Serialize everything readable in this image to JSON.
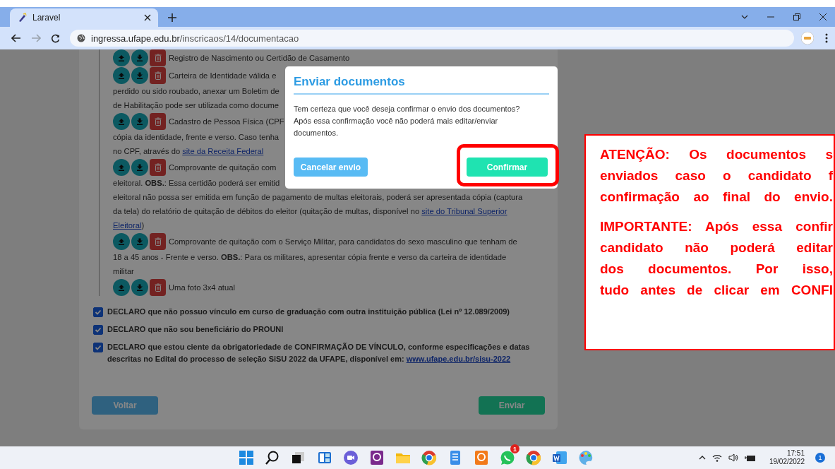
{
  "browser": {
    "tab": {
      "title": "Laravel",
      "selected": true
    },
    "address": {
      "host": "ingressa.ufape.edu.br",
      "path": "/inscricaos/14/documentacao"
    },
    "forward_disabled": true
  },
  "documents": [
    {
      "lines": [
        [
          {
            "kind": "text",
            "text": "Registro de Nascimento ou Certidão de Casamento"
          }
        ]
      ]
    },
    {
      "lines": [
        [
          {
            "kind": "text",
            "text": "Carteira de Identidade válida e"
          }
        ],
        [
          {
            "kind": "text",
            "text": "perdido ou sido roubado, anexar um Boletim de"
          }
        ],
        [
          {
            "kind": "text",
            "text": "de Habilitação pode ser utilizada como docume"
          }
        ]
      ]
    },
    {
      "lines": [
        [
          {
            "kind": "text",
            "text": "Cadastro de Pessoa Física (CPF"
          }
        ],
        [
          {
            "kind": "text",
            "text": "cópia da identidade, frente e verso. Caso tenha"
          }
        ],
        [
          {
            "kind": "text",
            "text": "no CPF, através do "
          },
          {
            "kind": "link",
            "text": "site da Receita Federal"
          }
        ]
      ]
    },
    {
      "lines": [
        [
          {
            "kind": "text",
            "text": "Comprovante de quitação com"
          }
        ],
        [
          {
            "kind": "text",
            "text": "eleitoral. **OBS.**: Essa certidão poderá ser emitid"
          }
        ],
        [
          {
            "kind": "text",
            "text": "eleitoral não possa ser emitida em função de pagamento de multas eleitorais, poderá ser apresentada cópia (captura"
          }
        ],
        [
          {
            "kind": "text",
            "text": "da tela) do relatório de quitação de débitos do eleitor (quitação de multas, disponível no "
          },
          {
            "kind": "link",
            "text": "site do Tribunal Superior"
          }
        ],
        [
          {
            "kind": "link",
            "text": "Eleitoral"
          },
          {
            "kind": "text",
            "text": ")"
          }
        ]
      ]
    },
    {
      "lines": [
        [
          {
            "kind": "text",
            "text": "Comprovante de quitação com o Serviço Militar, para candidatos do sexo masculino que tenham de"
          }
        ],
        [
          {
            "kind": "text",
            "text": "18 a 45 anos - Frente e verso. **OBS.**: Para os militares, apresentar cópia frente e verso da carteira de identidade"
          }
        ],
        [
          {
            "kind": "text",
            "text": "militar"
          }
        ]
      ]
    },
    {
      "lines": [
        [
          {
            "kind": "text",
            "text": "Uma foto 3x4 atual"
          }
        ]
      ]
    }
  ],
  "declarations": [
    {
      "checked": true,
      "parts": [
        {
          "kind": "text",
          "text": "DECLARO que não possuo vínculo em curso de graduação com outra instituição pública (Lei nº 12.089/2009)"
        }
      ]
    },
    {
      "checked": true,
      "parts": [
        {
          "kind": "text",
          "text": "DECLARO que não sou beneficiário do PROUNI"
        }
      ]
    },
    {
      "checked": true,
      "parts": [
        {
          "kind": "text",
          "text": "DECLARO que estou ciente da obrigatoriedade de CONFIRMAÇÃO DE VÍNCULO, conforme especificações e datas descritas no Edital do processo de seleção SiSU 2022 da UFAPE, disponível em: "
        },
        {
          "kind": "link",
          "text": "www.ufape.edu.br/sisu-2022"
        }
      ]
    }
  ],
  "actions": {
    "back": "Voltar",
    "submit": "Enviar"
  },
  "modal": {
    "title": "Enviar documentos",
    "message": "Tem certeza que você deseja confirmar o envio dos documentos? Após essa confirmação você não poderá mais editar/enviar documentos.",
    "cancel": "Cancelar envio",
    "confirm": "Confirmar",
    "confirm_highlighted": true
  },
  "callout": {
    "paragraphs": [
      [
        "ATENÇÃO: Os documentos s",
        "enviados caso o candidato f",
        "confirmação ao final do envio."
      ],
      [
        "IMPORTANTE: Após essa confir",
        "candidato não poderá editar",
        "dos documentos. Por isso,",
        "tudo antes de clicar em CONFI"
      ]
    ]
  },
  "taskbar": {
    "apps": [
      {
        "kind": "start"
      },
      {
        "kind": "search"
      },
      {
        "kind": "taskview"
      },
      {
        "kind": "widgets"
      },
      {
        "kind": "chat"
      },
      {
        "kind": "pdf"
      },
      {
        "kind": "folder"
      },
      {
        "kind": "browser"
      },
      {
        "kind": "notepad"
      },
      {
        "kind": "pdf2"
      },
      {
        "kind": "messenger",
        "badge": "1"
      },
      {
        "kind": "browser2"
      },
      {
        "kind": "word"
      },
      {
        "kind": "paint"
      }
    ],
    "time": "17:51",
    "date": "19/02/2022",
    "notifications": "1"
  }
}
